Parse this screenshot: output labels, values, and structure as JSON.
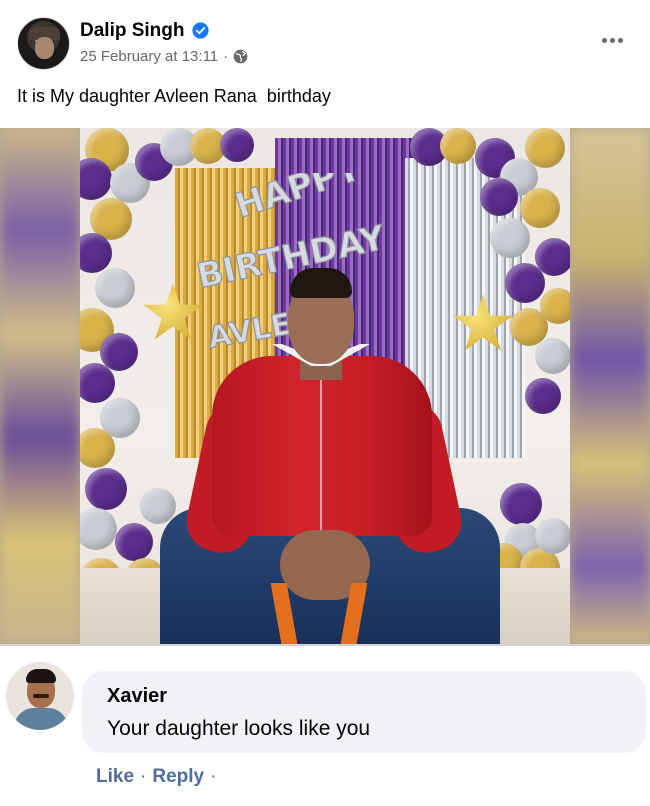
{
  "post": {
    "author": "Dalip Singh",
    "date": "25 February at 13:11",
    "meta_separator": "·",
    "text": "It is My daughter Avleen Rana  birthday",
    "icons": {
      "avatar": "profile-photo",
      "verified": "verified-badge-icon",
      "audience": "globe-icon",
      "menu": "more-options-icon"
    },
    "photo": {
      "banner_text": "HAPPY BIRTHDAY AVLEEN",
      "colors": {
        "balloon_purple": "#5b2d8e",
        "balloon_gold": "#d9b24a",
        "balloon_silver": "#c9ccd3",
        "shirt_red": "#c61e27"
      }
    }
  },
  "comment": {
    "author": "Xavier",
    "text": "Your daughter looks like you",
    "actions": {
      "like": "Like",
      "reply": "Reply",
      "separator": "·",
      "trailing_separator": "·"
    }
  },
  "colors": {
    "verified_blue": "#1877f2",
    "meta_gray": "#65676b",
    "link_blue": "#4e6c9e",
    "bubble_bg": "#f0f2f5"
  }
}
